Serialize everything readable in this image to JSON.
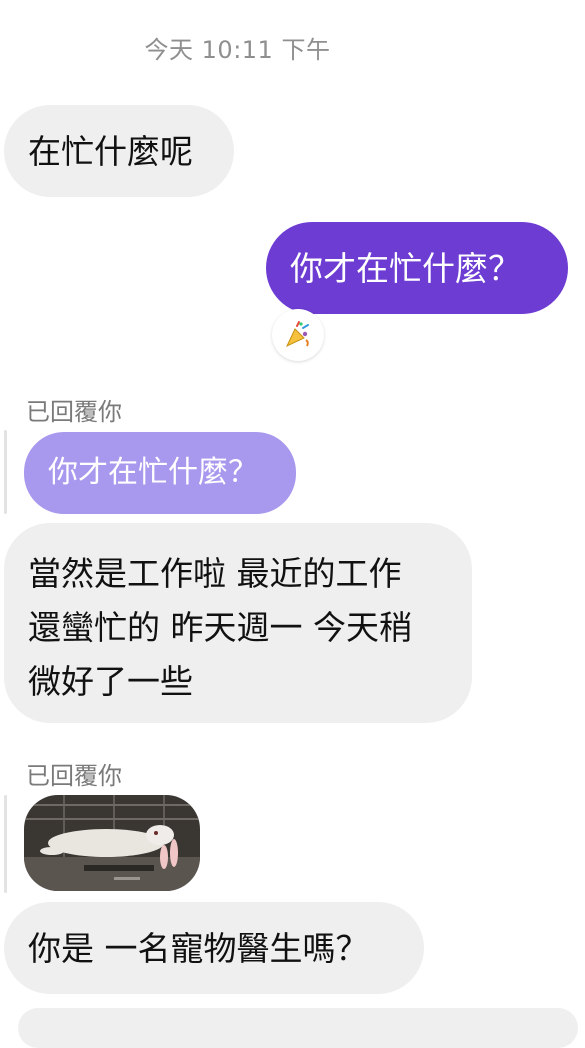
{
  "timestamp": "今天 10:11 下午",
  "messages": {
    "incoming_1": "在忙什麼呢",
    "outgoing_1": "你才在忙什麼？",
    "reply_label_1": "已回覆你",
    "quoted_1": "你才在忙什麼？",
    "incoming_2_line1": "當然是工作啦 最近的工作",
    "incoming_2_line2": "還蠻忙的 昨天週一 今天稍",
    "incoming_2_line3": "微好了一些",
    "reply_label_2": "已回覆你",
    "incoming_3": "你是 一名寵物醫生嗎？"
  },
  "reaction": {
    "icon": "party-popper-icon"
  },
  "quoted_image": {
    "icon": "photo-thumbnail-icon"
  },
  "colors": {
    "outgoing_bubble": "#6d3cd3",
    "incoming_bubble": "#efefef",
    "quoted_bubble": "#a999ee"
  }
}
